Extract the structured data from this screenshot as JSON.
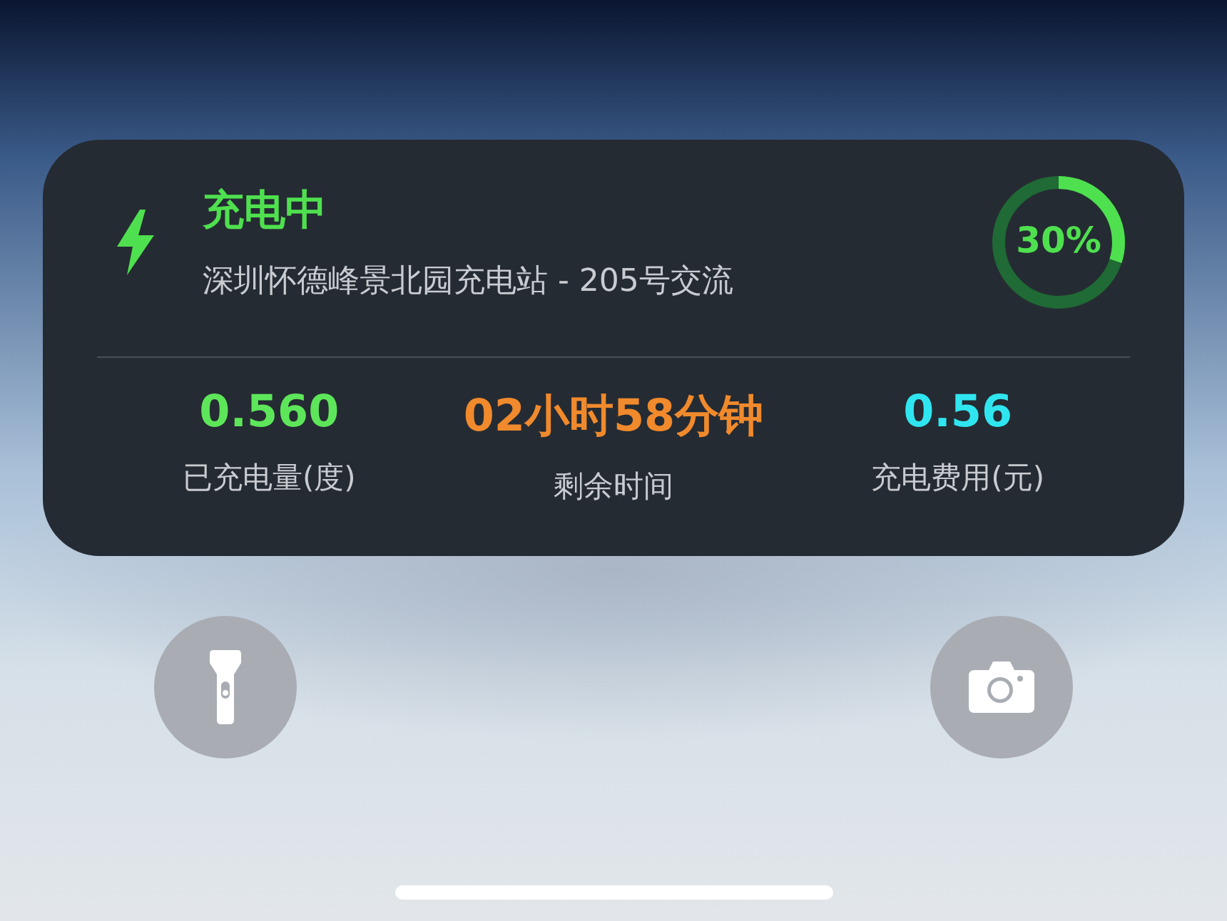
{
  "activity": {
    "status": "充电中",
    "station": "深圳怀德峰景北园充电站 - 205号交流",
    "progress": {
      "label": "30%",
      "level": 0.3
    },
    "stats": [
      {
        "value": "0.560",
        "label": "已充电量(度)",
        "color": "#5ee65a"
      },
      {
        "value": "02小时58分钟",
        "label": "剩余时间",
        "color": "#f08a2c"
      },
      {
        "value": "0.56",
        "label": "充电费用(元)",
        "color": "#2fe6f0"
      }
    ]
  },
  "quick_actions": [
    {
      "kind": "flashlight"
    },
    {
      "kind": "camera"
    }
  ]
}
